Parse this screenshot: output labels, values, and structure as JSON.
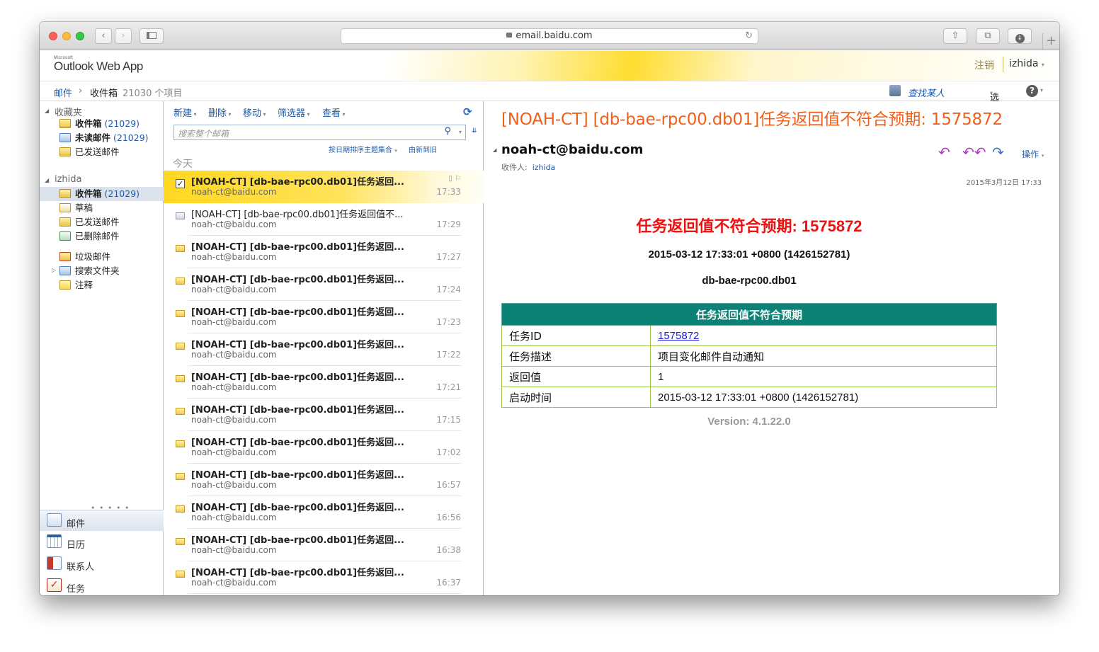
{
  "browser": {
    "url": "email.baidu.com"
  },
  "app": {
    "logo_small": "Microsoft",
    "logo": "Outlook Web App",
    "signout": "注销",
    "user": "izhida"
  },
  "crumb": {
    "mail": "邮件",
    "sep": "›",
    "folder": "收件箱",
    "count": "21030 个项目",
    "find": "查找某人",
    "options": "选项",
    "help": "?"
  },
  "favorites": {
    "label": "收藏夹",
    "items": [
      {
        "label": "收件箱",
        "count": "(21029)"
      },
      {
        "label": "未读邮件",
        "count": "(21029)"
      },
      {
        "label": "已发送邮件",
        "count": ""
      }
    ]
  },
  "account": {
    "label": "izhida",
    "items": [
      {
        "label": "收件箱",
        "count": "(21029)"
      },
      {
        "label": "草稿",
        "count": ""
      },
      {
        "label": "已发送邮件",
        "count": ""
      },
      {
        "label": "已删除邮件",
        "count": ""
      },
      {
        "label": "垃圾邮件",
        "count": ""
      },
      {
        "label": "搜索文件夹",
        "count": ""
      },
      {
        "label": "注释",
        "count": ""
      }
    ]
  },
  "nav": {
    "grip": "• • • • •",
    "mail": "邮件",
    "calendar": "日历",
    "contacts": "联系人",
    "tasks": "任务"
  },
  "toolbar": {
    "new": "新建",
    "delete": "删除",
    "move": "移动",
    "filter": "筛选器",
    "view": "查看"
  },
  "search": {
    "placeholder": "搜索整个邮箱"
  },
  "sort": {
    "by": "按日期排序主题集合",
    "order": "由新到旧"
  },
  "group": "今天",
  "messages": [
    {
      "subject": "[NOAH-CT] [db-bae-rpc00.db01]任务返回...",
      "from": "noah-ct@baidu.com",
      "time": "17:33"
    },
    {
      "subject": "[NOAH-CT] [db-bae-rpc00.db01]任务返回值不...",
      "from": "noah-ct@baidu.com",
      "time": "17:29"
    },
    {
      "subject": "[NOAH-CT] [db-bae-rpc00.db01]任务返回...",
      "from": "noah-ct@baidu.com",
      "time": "17:27"
    },
    {
      "subject": "[NOAH-CT] [db-bae-rpc00.db01]任务返回...",
      "from": "noah-ct@baidu.com",
      "time": "17:24"
    },
    {
      "subject": "[NOAH-CT] [db-bae-rpc00.db01]任务返回...",
      "from": "noah-ct@baidu.com",
      "time": "17:23"
    },
    {
      "subject": "[NOAH-CT] [db-bae-rpc00.db01]任务返回...",
      "from": "noah-ct@baidu.com",
      "time": "17:22"
    },
    {
      "subject": "[NOAH-CT] [db-bae-rpc00.db01]任务返回...",
      "from": "noah-ct@baidu.com",
      "time": "17:21"
    },
    {
      "subject": "[NOAH-CT] [db-bae-rpc00.db01]任务返回...",
      "from": "noah-ct@baidu.com",
      "time": "17:15"
    },
    {
      "subject": "[NOAH-CT] [db-bae-rpc00.db01]任务返回...",
      "from": "noah-ct@baidu.com",
      "time": "17:02"
    },
    {
      "subject": "[NOAH-CT] [db-bae-rpc00.db01]任务返回...",
      "from": "noah-ct@baidu.com",
      "time": "16:57"
    },
    {
      "subject": "[NOAH-CT] [db-bae-rpc00.db01]任务返回...",
      "from": "noah-ct@baidu.com",
      "time": "16:56"
    },
    {
      "subject": "[NOAH-CT] [db-bae-rpc00.db01]任务返回...",
      "from": "noah-ct@baidu.com",
      "time": "16:38"
    },
    {
      "subject": "[NOAH-CT] [db-bae-rpc00.db01]任务返回...",
      "from": "noah-ct@baidu.com",
      "time": "16:37"
    }
  ],
  "reading": {
    "subject": "[NOAH-CT] [db-bae-rpc00.db01]任务返回值不符合预期: 1575872",
    "from": "noah-ct@baidu.com",
    "to_label": "收件人:",
    "to": "izhida",
    "date": "2015年3月12日 17:33",
    "actions": "操作",
    "h1": "任务返回值不符合预期: 1575872",
    "h2": "2015-03-12 17:33:01 +0800 (1426152781)",
    "h3": "db-bae-rpc00.db01",
    "table": {
      "title": "任务返回值不符合预期",
      "rows": [
        {
          "k": "任务ID",
          "v": "1575872"
        },
        {
          "k": "任务描述",
          "v": "项目变化邮件自动通知"
        },
        {
          "k": "返回值",
          "v": "1"
        },
        {
          "k": "启动时间",
          "v": "2015-03-12 17:33:01 +0800 (1426152781)"
        }
      ]
    },
    "version": "Version: 4.1.22.0"
  }
}
